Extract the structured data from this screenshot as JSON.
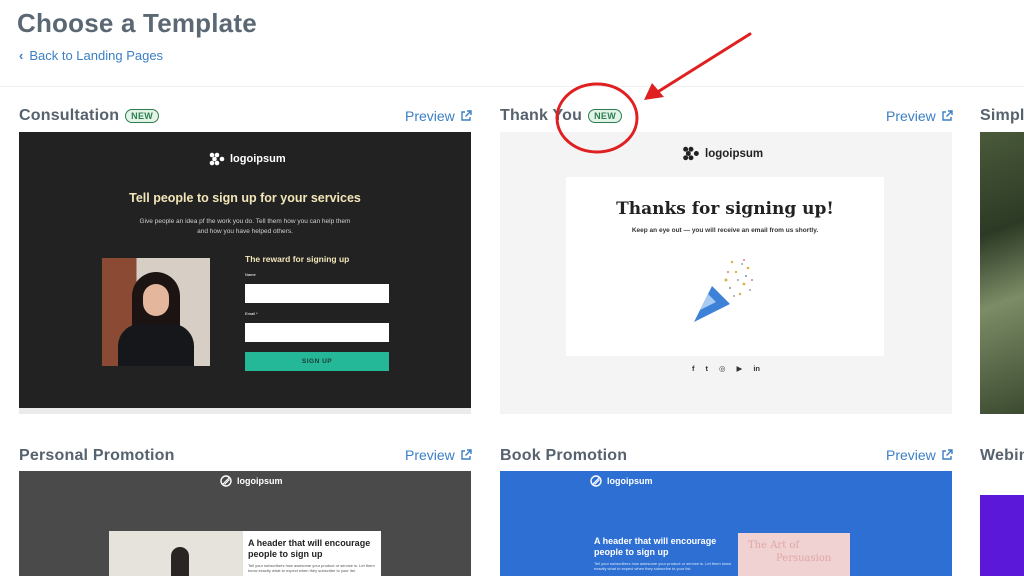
{
  "page": {
    "title": "Choose a Template",
    "back_link": "Back to Landing Pages"
  },
  "templates": [
    {
      "title": "Consultation",
      "badge": "NEW",
      "preview": "Preview",
      "thumb": {
        "logo": "logoipsum",
        "headline": "Tell people to sign up for your services",
        "subtext": "Give people an idea pf the work you do. Tell them how you can help them and how you have helped others.",
        "form_title": "The reward for signing up",
        "name_label": "Name",
        "email_label": "Email *",
        "button": "SIGN UP"
      }
    },
    {
      "title": "Thank You",
      "badge": "NEW",
      "preview": "Preview",
      "thumb": {
        "logo": "logoipsum",
        "headline": "Thanks for signing up!",
        "subtext": "Keep an eye out — you will receive an email from us shortly.",
        "socials": [
          "f",
          "t",
          "◎",
          "▶",
          "in"
        ]
      }
    },
    {
      "title": "Simple"
    },
    {
      "title": "Personal Promotion",
      "preview": "Preview",
      "thumb": {
        "logo": "logoipsum",
        "header": "A header that will encourage people to sign up",
        "body": "Tell your subscribers how awesome your product or service is. Let them know exactly what to expect when they subscribe to your list."
      }
    },
    {
      "title": "Book Promotion",
      "preview": "Preview",
      "thumb": {
        "logo": "logoipsum",
        "header": "A header that will encourage people to sign up",
        "body": "Tell your subscribers how awesome your product or service is. Let them know exactly what to expect when they subscribe to your list.",
        "book_line1": "The Art of",
        "book_line2": "Persuasion"
      }
    },
    {
      "title": "Webin"
    }
  ],
  "colors": {
    "link": "#3b7fc4",
    "badge_green": "#2e7d4f",
    "annotation_red": "#e02020",
    "signup_button": "#25b898",
    "book_blue": "#2d6fd2",
    "webinar_purple": "#5b18d8"
  }
}
